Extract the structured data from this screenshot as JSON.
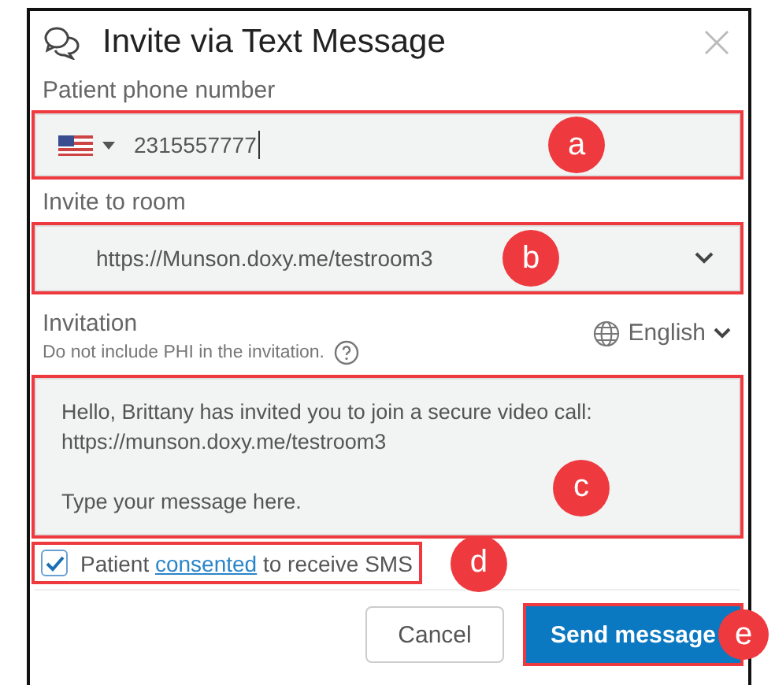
{
  "dialog": {
    "title": "Invite via Text Message"
  },
  "phone": {
    "label": "Patient phone number",
    "value": "2315557777",
    "callout": "a"
  },
  "room": {
    "label": "Invite to room",
    "value": "https://Munson.doxy.me/testroom3",
    "callout": "b"
  },
  "invitation": {
    "label": "Invitation",
    "note": "Do not include PHI in the invitation.",
    "language": "English",
    "message_paragraphs": [
      "Hello, Brittany has invited you to join a secure video call:\nhttps://munson.doxy.me/testroom3",
      "Type your message here."
    ],
    "callout": "c"
  },
  "consent": {
    "checked": true,
    "before": "Patient",
    "link": "consented",
    "after": "to receive SMS",
    "callout": "d"
  },
  "buttons": [
    {
      "label": "Cancel",
      "kind": "secondary"
    },
    {
      "label": "Send message",
      "kind": "primary",
      "callout": "e"
    }
  ]
}
